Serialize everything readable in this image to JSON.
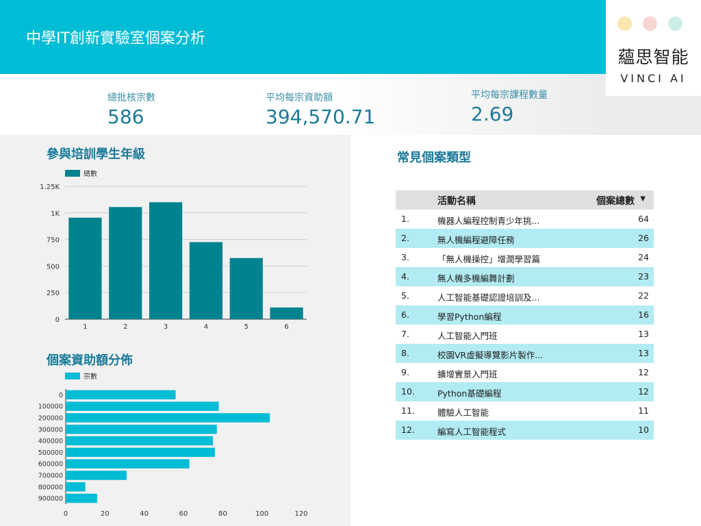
{
  "header": {
    "title": "中學IT創新實驗室個案分析"
  },
  "logo": {
    "cn": "蘊思智能",
    "en": "VINCI AI",
    "dot_colors": [
      "#fbe6b0",
      "#f6d5d2",
      "#cdeee6"
    ]
  },
  "kpis": [
    {
      "label": "總批核宗數",
      "value": "586"
    },
    {
      "label": "平均每宗資助額",
      "value": "394,570.71"
    },
    {
      "label": "平均每宗課程數量",
      "value": "2.69"
    }
  ],
  "colors": {
    "accent": "#00BCD4",
    "bar1": "#00838F",
    "bar2": "#00BCD4",
    "kpi_text": "#1a7a98",
    "row_alt": "#b2ebf2"
  },
  "chart_data": [
    {
      "type": "bar",
      "title": "參與培訓學生年級",
      "legend": "總數",
      "categories": [
        "1",
        "2",
        "3",
        "4",
        "5",
        "6"
      ],
      "values": [
        955,
        1055,
        1100,
        725,
        575,
        110
      ],
      "yticks": [
        "0",
        "250",
        "500",
        "750",
        "1K",
        "1.25K"
      ],
      "ytick_values": [
        0,
        250,
        500,
        750,
        1000,
        1250
      ],
      "ylim": [
        0,
        1250
      ],
      "grid": true,
      "legend_position": "top-left"
    },
    {
      "type": "bar",
      "orientation": "horizontal",
      "title": "個案資助額分佈",
      "legend": "宗數",
      "categories": [
        "0",
        "100000",
        "200000",
        "300000",
        "400000",
        "500000",
        "600000",
        "700000",
        "800000",
        "900000"
      ],
      "values": [
        56,
        78,
        104,
        77,
        75,
        76,
        63,
        31,
        10,
        16
      ],
      "xticks": [
        "0",
        "20",
        "40",
        "60",
        "80",
        "100",
        "120"
      ],
      "xtick_values": [
        0,
        20,
        40,
        60,
        80,
        100,
        120
      ],
      "xlim": [
        0,
        120
      ],
      "grid": false,
      "legend_position": "top-left"
    }
  ],
  "table": {
    "title": "常見個案類型",
    "col_name": "活動名稱",
    "col_count": "個案總數",
    "rows": [
      {
        "idx": "1.",
        "name": "機器人編程控制青少年挑...",
        "count": "64"
      },
      {
        "idx": "2.",
        "name": "無人機編程避障任務",
        "count": "26"
      },
      {
        "idx": "3.",
        "name": "「無人機操控」增潤學習篇",
        "count": "24"
      },
      {
        "idx": "4.",
        "name": "無人機多機編舞計劃",
        "count": "23"
      },
      {
        "idx": "5.",
        "name": "人工智能基礎認證培訓及...",
        "count": "22"
      },
      {
        "idx": "6.",
        "name": "學習Python編程",
        "count": "16"
      },
      {
        "idx": "7.",
        "name": "人工智能入門班",
        "count": "13"
      },
      {
        "idx": "8.",
        "name": "校園VR虛擬導覽影片製作...",
        "count": "13"
      },
      {
        "idx": "9.",
        "name": "擴增實景入門班",
        "count": "12"
      },
      {
        "idx": "10.",
        "name": "Python基礎編程",
        "count": "12"
      },
      {
        "idx": "11.",
        "name": "體驗人工智能",
        "count": "11"
      },
      {
        "idx": "12.",
        "name": "編寫人工智能程式",
        "count": "10"
      }
    ]
  }
}
